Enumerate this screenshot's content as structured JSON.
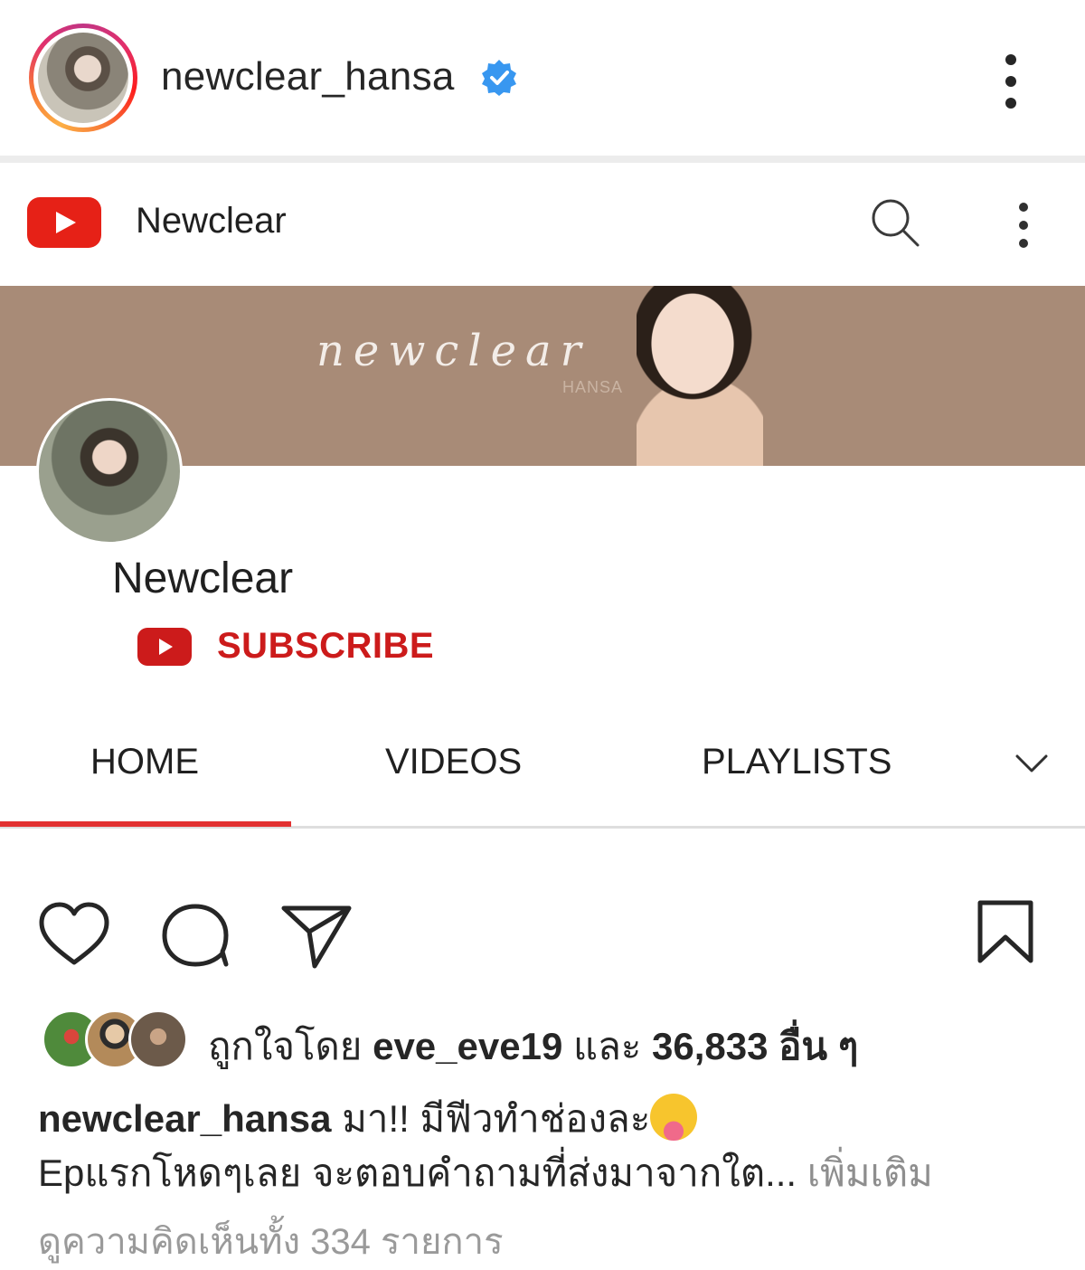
{
  "post_header": {
    "username": "newclear_hansa",
    "verified": true,
    "accent_color": "#3897f0"
  },
  "youtube": {
    "channel_title": "Newclear",
    "banner": {
      "script_text": "newclear",
      "sub_text": "HANSA"
    },
    "channel_name": "Newclear",
    "subscribe_label": "SUBSCRIBE",
    "tabs": [
      {
        "label": "HOME",
        "active": true
      },
      {
        "label": "VIDEOS",
        "active": false
      },
      {
        "label": "PLAYLISTS",
        "active": false
      }
    ],
    "brand_color": "#e62117"
  },
  "actions": {
    "icons": [
      "heart-icon",
      "comment-icon",
      "share-icon",
      "bookmark-icon"
    ]
  },
  "likes": {
    "prefix": "ถูกใจโดย",
    "liker": "eve_eve19",
    "conjunction": "และ",
    "count_text": "36,833 อื่น ๆ"
  },
  "caption": {
    "username": "newclear_hansa",
    "line1": "มา!! มีฟีวทำช่องละ",
    "emoji": "squinting-face-with-tongue",
    "line2": "Epแรกโหดๆเลย จะตอบคำถามที่ส่งมาจากใต...",
    "more_label": "เพิ่มเติม"
  },
  "comments_link": "ดูความคิดเห็นทั้ง 334 รายการ"
}
